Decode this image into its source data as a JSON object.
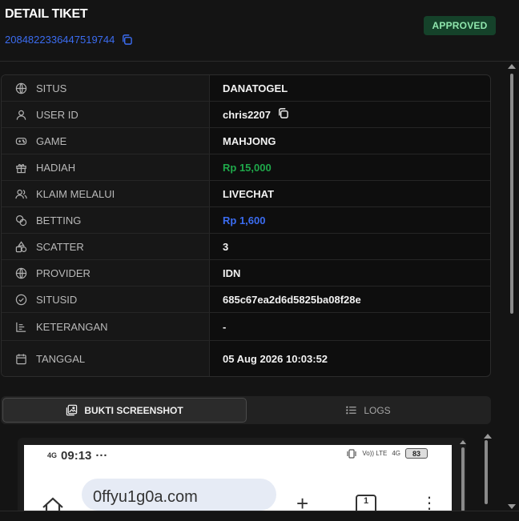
{
  "header": {
    "title": "DETAIL TIKET",
    "ticket_id": "2084822336447519744",
    "status": "APPROVED"
  },
  "details": [
    {
      "label": "SITUS",
      "value": "DANATOGEL",
      "icon": "globe-icon",
      "tone": "default"
    },
    {
      "label": "USER ID",
      "value": "chris2207",
      "icon": "user-icon",
      "tone": "default",
      "copyable": true
    },
    {
      "label": "GAME",
      "value": "MAHJONG",
      "icon": "gamepad-icon",
      "tone": "default"
    },
    {
      "label": "HADIAH",
      "value": "Rp 15,000",
      "icon": "gift-icon",
      "tone": "green"
    },
    {
      "label": "KLAIM MELALUI",
      "value": "LIVECHAT",
      "icon": "users-icon",
      "tone": "default"
    },
    {
      "label": "BETTING",
      "value": "Rp 1,600",
      "icon": "coins-icon",
      "tone": "blue"
    },
    {
      "label": "SCATTER",
      "value": "3",
      "icon": "shapes-icon",
      "tone": "default"
    },
    {
      "label": "PROVIDER",
      "value": "IDN",
      "icon": "globe-icon",
      "tone": "default"
    },
    {
      "label": "SITUSID",
      "value": "685c67ea2d6d5825ba08f28e",
      "icon": "check-circle-icon",
      "tone": "default"
    },
    {
      "label": "KETERANGAN",
      "value": "-",
      "icon": "text-align-icon",
      "tone": "default"
    },
    {
      "label": "TANGGAL",
      "value": "05 Aug 2026 10:03:52",
      "icon": "calendar-icon",
      "tone": "default"
    }
  ],
  "tabs": {
    "screenshot": "BUKTI SCREENSHOT",
    "logs": "LOGS"
  },
  "screenshot": {
    "net_label": "4G",
    "time": "09:13",
    "dots": "···",
    "volte": "Vo)) LTE",
    "signal": "4G",
    "battery": "83",
    "url": "0ffyu1g0a.com",
    "tab_count": "1"
  },
  "colors": {
    "accent_blue": "#3b6cf0",
    "success_green": "#1fa84a",
    "badge_bg": "#15422a"
  }
}
